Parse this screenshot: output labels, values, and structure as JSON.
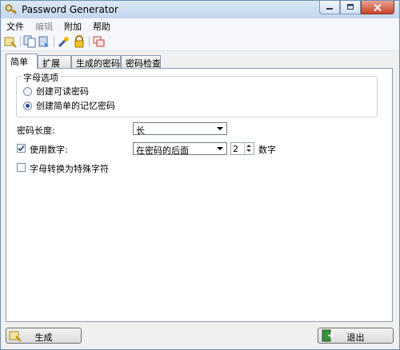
{
  "window": {
    "title": "Password Generator"
  },
  "menu": [
    {
      "label": "文件",
      "disabled": false
    },
    {
      "label": "编辑",
      "disabled": true
    },
    {
      "label": "附加",
      "disabled": false
    },
    {
      "label": "帮助",
      "disabled": false
    }
  ],
  "tabs": [
    "简单",
    "扩展",
    "生成的密码",
    "密码检查"
  ],
  "letter_options": {
    "legend": "字母选项",
    "readable": "创建可读密码",
    "memorable": "创建简单的记忆密码",
    "selected": "memorable"
  },
  "length": {
    "label": "密码长度:",
    "value": "长"
  },
  "digits": {
    "label": "使用数字:",
    "checked": true,
    "position": "在密码的后面",
    "count": "2",
    "unit": "数字"
  },
  "special": {
    "label": "字母转换为特殊字符",
    "checked": false
  },
  "buttons": {
    "generate": "生成",
    "exit": "退出"
  }
}
